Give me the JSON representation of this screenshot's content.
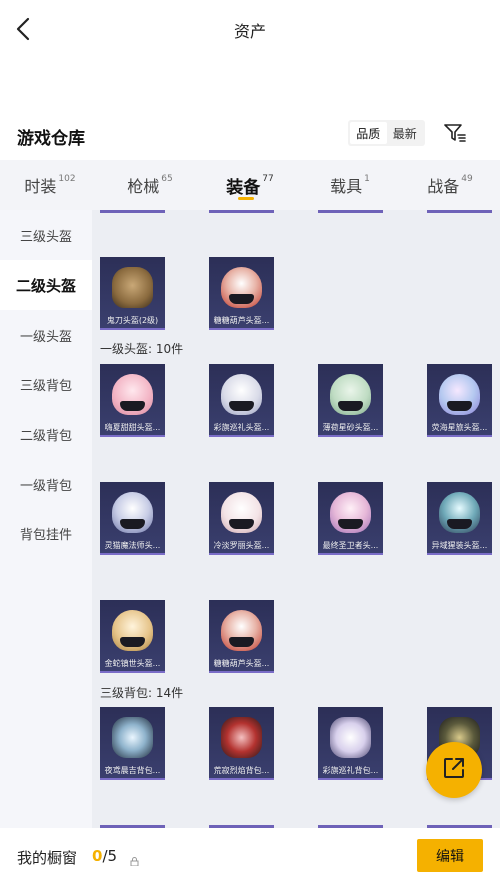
{
  "header": {
    "title": "资产"
  },
  "warehouse": {
    "title": "游戏仓库",
    "sort_options": [
      "品质",
      "最新"
    ],
    "active_sort": 0
  },
  "tabs": [
    {
      "label": "时装",
      "count": "102"
    },
    {
      "label": "枪械",
      "count": "65"
    },
    {
      "label": "装备",
      "count": "77",
      "active": true
    },
    {
      "label": "载具",
      "count": "1"
    },
    {
      "label": "战备",
      "count": "49"
    }
  ],
  "sidebar": {
    "items": [
      {
        "label": "三级头盔"
      },
      {
        "label": "二级头盔",
        "active": true
      },
      {
        "label": "一级头盔"
      },
      {
        "label": "三级背包"
      },
      {
        "label": "二级背包"
      },
      {
        "label": "一级背包"
      },
      {
        "label": "背包挂件"
      }
    ]
  },
  "sections": {
    "level2_helmets": {
      "items": [
        {
          "name": "鬼刀头盔(2级)"
        },
        {
          "name": "糖糖葫芦头盔..."
        }
      ]
    },
    "level1_helmets": {
      "label": "一级头盔: 10件",
      "items": [
        {
          "name": "嗨夏甜甜头盔..."
        },
        {
          "name": "彩旗巡礼头盔..."
        },
        {
          "name": "薄荷星砂头盔..."
        },
        {
          "name": "荧海星旅头盔..."
        },
        {
          "name": "灵猫魔法师头..."
        },
        {
          "name": "冷淡罗丽头盔..."
        },
        {
          "name": "最终圣卫者头..."
        },
        {
          "name": "异域猩装头盔..."
        },
        {
          "name": "金蛇镇世头盔..."
        },
        {
          "name": "糖糖葫芦头盔..."
        }
      ]
    },
    "level3_backpacks": {
      "label": "三级背包: 14件",
      "items": [
        {
          "name": "夜鸢晨吉背包..."
        },
        {
          "name": "荒寂烈焰背包..."
        },
        {
          "name": "彩旗巡礼背包..."
        },
        {
          "name": ""
        }
      ]
    }
  },
  "bottom": {
    "showcase_label": "我的橱窗",
    "current": "0",
    "total": "/5",
    "edit_label": "编辑"
  },
  "colors": {
    "accent": "#f5b100",
    "card_bg": "#2c2f57",
    "card_border": "#7a6cc7"
  }
}
